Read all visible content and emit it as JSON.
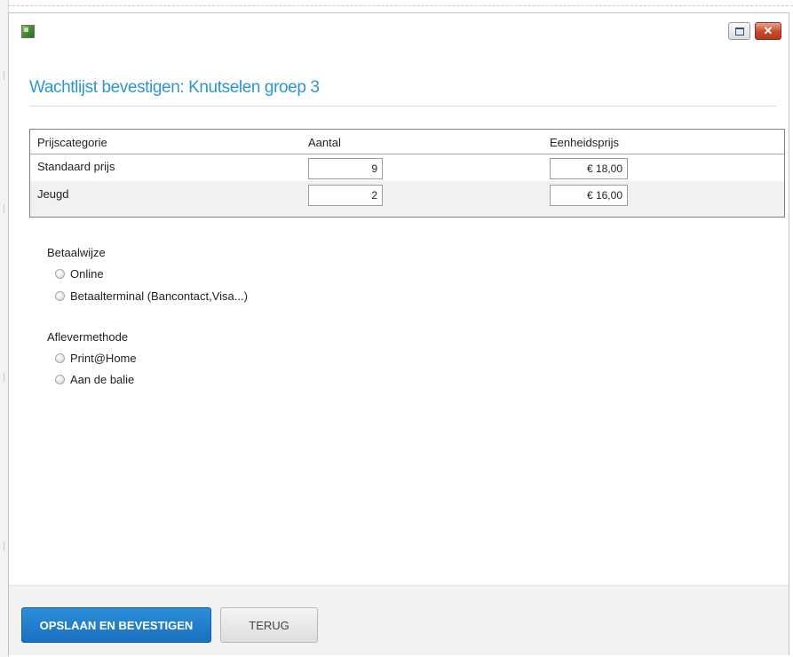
{
  "window": {
    "icon": "app-logo-icon",
    "maximize_icon": "maximize-icon",
    "close_icon": "close-icon",
    "close_glyph": "✕"
  },
  "dialog": {
    "title": "Wachtlijst bevestigen: Knutselen groep 3"
  },
  "price_table": {
    "headers": [
      "Prijscategorie",
      "Aantal",
      "Eenheidsprijs"
    ],
    "rows": [
      {
        "category": "Standaard prijs",
        "quantity": "9",
        "unit_price": "€ 18,00"
      },
      {
        "category": "Jeugd",
        "quantity": "2",
        "unit_price": "€ 16,00"
      }
    ]
  },
  "payment": {
    "label": "Betaalwijze",
    "options": [
      "Online",
      "Betaalterminal (Bancontact,Visa...)"
    ],
    "selected": null
  },
  "delivery": {
    "label": "Aflevermethode",
    "options": [
      "Print@Home",
      "Aan de balie"
    ],
    "selected": null
  },
  "footer": {
    "confirm_label": "OPSLAAN EN BEVESTIGEN",
    "back_label": "TERUG"
  },
  "colors": {
    "title": "#2d95d3",
    "primary_button": "#1a78c8",
    "close_button": "#c7492c"
  }
}
